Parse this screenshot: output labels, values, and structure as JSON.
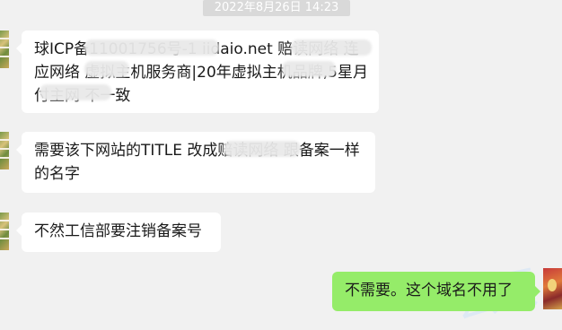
{
  "timestamp": "2022年8月26日 14:23",
  "messages": [
    {
      "sender": "other",
      "text": "球ICP备11001756号-1 iidaio.net 赔读网络 连应网络 虚拟主机服务商|20年虚拟主机品牌,5星月付主网 不一致"
    },
    {
      "sender": "other",
      "text": "需要该下网站的TITLE 改成赔读网络 跟备案一样的名字"
    },
    {
      "sender": "other",
      "text": "不然工信部要注销备案号"
    },
    {
      "sender": "self",
      "text": "不需要。这个域名不用了"
    }
  ],
  "colors": {
    "background": "#f1f1f1",
    "bubble_other": "#ffffff",
    "bubble_self": "#95ec69",
    "timestamp_bg": "#d9d9d9"
  }
}
